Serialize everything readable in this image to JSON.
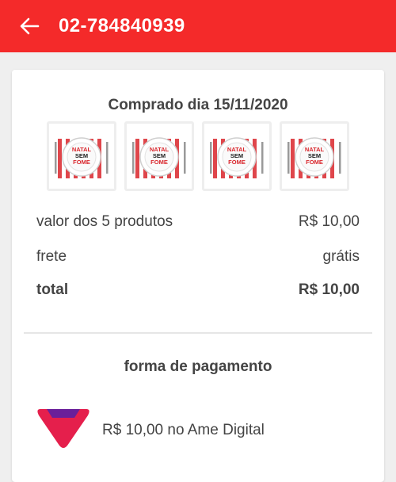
{
  "header": {
    "title": "02-784840939",
    "back_icon": "arrow-left-icon",
    "background": "#f42a2a"
  },
  "order": {
    "purchase_date": "Comprado dia 15/11/2020",
    "products": [
      {
        "image": "natal-sem-fome-plate",
        "label": [
          "NATAL",
          "SEM",
          "FOME"
        ]
      },
      {
        "image": "natal-sem-fome-plate",
        "label": [
          "NATAL",
          "SEM",
          "FOME"
        ]
      },
      {
        "image": "natal-sem-fome-plate",
        "label": [
          "NATAL",
          "SEM",
          "FOME"
        ]
      },
      {
        "image": "natal-sem-fome-plate",
        "label": [
          "NATAL",
          "SEM",
          "FOME"
        ]
      }
    ],
    "summary": [
      {
        "label": "valor dos 5 produtos",
        "value": "R$ 10,00"
      },
      {
        "label": "frete",
        "value": "grátis"
      },
      {
        "label": "total",
        "value": "R$ 10,00"
      }
    ]
  },
  "payment": {
    "title": "forma de pagamento",
    "method_text": "R$ 10,00 no Ame Digital",
    "logo": "ame-digital-logo",
    "logo_colors": {
      "top": "#6a1f9a",
      "bottom": "#e51f4c"
    }
  }
}
